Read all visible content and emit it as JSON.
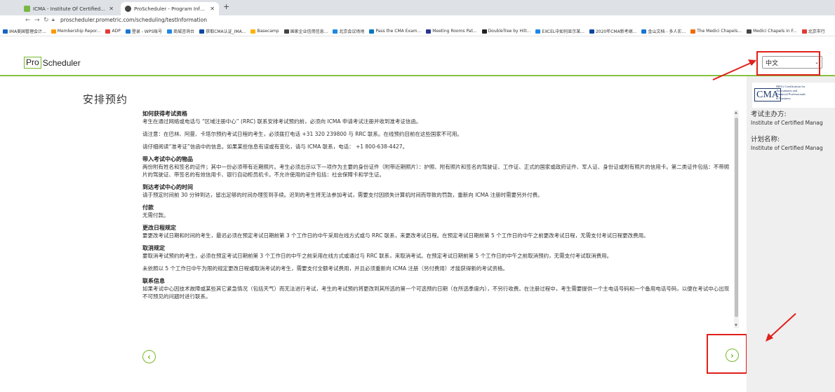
{
  "browser": {
    "tabs": [
      {
        "title": "ICMA - Institute Of Certified Man",
        "favicon_color": "#7ab648"
      },
      {
        "title": "ProScheduler - Program Informat",
        "favicon_color": "#444444"
      }
    ],
    "url": "proscheduler.prometric.com/scheduling/testInformation",
    "bookmarks": [
      "IMA美国管理会计...",
      "Membership Repor...",
      "ADP",
      "登录 - WPS账号",
      "商城咨询台",
      "获取CMA认证_IMA...",
      "Basecamp",
      "国家企业信用信息...",
      "北京会议场地",
      "Pass the CMA Exam...",
      "Meeting Rooms Pat...",
      "DoubleTree by Hilt...",
      "EXCEL中如何显示某...",
      "2020年CMA新考纲...",
      "金山文档 - 多人实...",
      "The Medici Chapels...",
      "Medici Chapels in F...",
      "北京市行"
    ]
  },
  "header": {
    "logo_pro": "Pro",
    "logo_scheduler": "Scheduler",
    "language": "中文"
  },
  "main": {
    "title": "安排预约",
    "sections": [
      {
        "heading": "如何获得考试资格",
        "body": [
          "考生在通过网络或电话与 “区域注册中心” (RRC) 联系安排考试预约前，必须向 ICMA 申请考试注册并收到准考证信函。"
        ]
      },
      {
        "heading": "",
        "body": [
          "请注意：在巴林、阿曼、卡塔尔预约考试日程的考生，必须拨打电话 +31 320 239800 与 RRC 联系。在线预约目前在这些国家不可用。"
        ]
      },
      {
        "heading": "",
        "body": [
          "请仔细阅读“准考证”信函中的信息。如果某些信息有误或有变化，请与 ICMA 联系，电话： +1 800-638-4427。"
        ]
      },
      {
        "heading": "带入考试中心的物品",
        "body": [
          "两份附有姓名和签名的证件；其中一份必须带有近期照片。考生必须出示以下一项作为主要的身份证件（附带近期照片）：护照、附有照片和签名的驾驶证、工作证、正式的国家或政府证件、军人证、身份证或附有照片的信用卡。第二类证件包括：不带照片的驾驶证、带签名的有效信用卡、银行自动柜员机卡。不允许使用的证件包括：社会保障卡和学生证。"
        ]
      },
      {
        "heading": "到达考试中心的时间",
        "body": [
          "请于预定时间前 30 分钟到达，留出足够的时间办理签到手续。迟到的考生将无法参加考试，需要支付因损失计算机时间而导致的罚款，重新向 ICMA 注册时需要另外付费。"
        ]
      },
      {
        "heading": "付款",
        "body": [
          "无需付款。"
        ]
      },
      {
        "heading": "更改日程规定",
        "body": [
          "要更改考试日期和时间的考生，最迟必须在预定考试日期前第 3 个工作日的中午采用在线方式或与 RRC 联系，来更改考试日程。在预定考试日期前第 5 个工作日的中午之前更改考试日程，无需支付考试日程更改费用。"
        ]
      },
      {
        "heading": "取消规定",
        "body": [
          "要取消考试预约的考生，必须在预定考试日期前第 3 个工作日的中午之前采用在线方式或通过与 RRC 联系，来取消考试。在预定考试日期前第 5 个工作日的中午之前取消预约，无需支付考试取消费用。"
        ]
      },
      {
        "heading": "",
        "body": [
          "未依照以 5 个工作日中午为限的规定更改日程或取消考试的考生，需要支付全额考试费用，并且必须重新向 ICMA 注册（另付费用）才能获得新的考试资格。"
        ]
      },
      {
        "heading": "联系信息",
        "body": [
          "如果考试中心因技术故障或某些其它紧急情况（包括天气）而无法进行考试，考生的考试预约将更改到其所选的第一个可选预约日期（在所选季度内），不另行收费。在注册过程中，考生需要提供一个主电话号码和一个备用电话号码，以便在考试中心出现不可预见的问题时进行联系。"
        ]
      }
    ]
  },
  "sidebar": {
    "logo_text": "CMA",
    "logo_tagline": "IMA's Certification for Accountants and Financial Professionals in Business",
    "sponsor_label": "考试主办方:",
    "sponsor_value": "Institute of Certified Manag",
    "program_label": "计划名称:",
    "program_value": "Institute of Certified Manag"
  },
  "nav": {
    "prev": "‹",
    "next": "›"
  },
  "colors": {
    "accent_green": "#78b82a",
    "annotation_red": "#e0201a"
  }
}
